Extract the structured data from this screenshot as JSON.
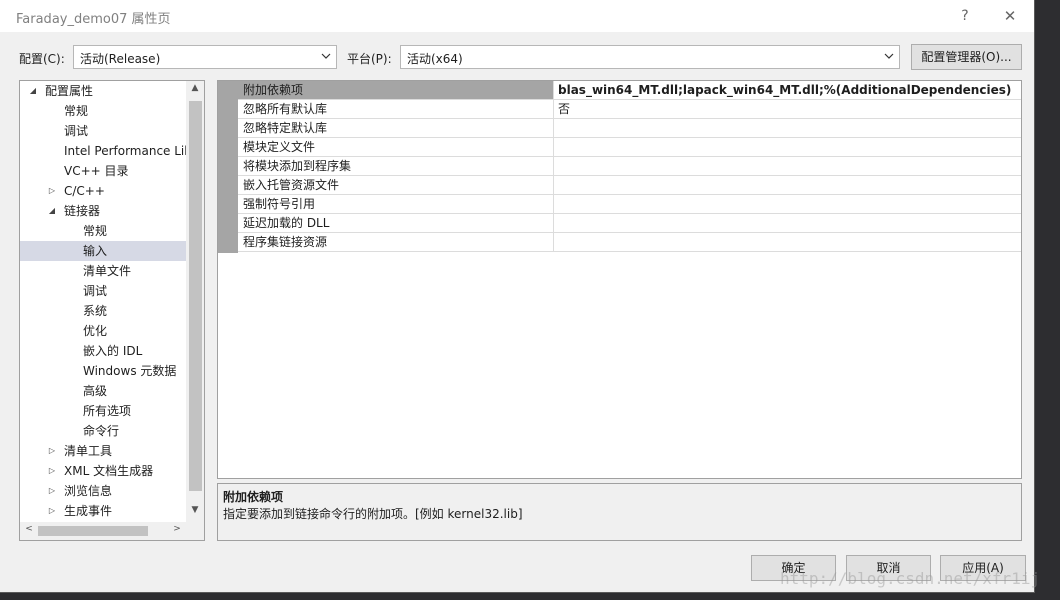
{
  "window": {
    "title": "Faraday_demo07 属性页",
    "help_glyph": "?",
    "close_glyph": "✕"
  },
  "toolbar": {
    "config_label": "配置(C):",
    "config_value": "活动(Release)",
    "platform_label": "平台(P):",
    "platform_value": "活动(x64)",
    "config_manager_label": "配置管理器(O)..."
  },
  "tree": {
    "items": [
      {
        "label": "配置属性",
        "toggle": "◢"
      },
      {
        "label": "常规",
        "toggle": ""
      },
      {
        "label": "调试",
        "toggle": ""
      },
      {
        "label": "Intel Performance Libraries",
        "toggle": ""
      },
      {
        "label": "VC++ 目录",
        "toggle": ""
      },
      {
        "label": "C/C++",
        "toggle": "▷"
      },
      {
        "label": "链接器",
        "toggle": "◢"
      },
      {
        "label": "常规",
        "toggle": ""
      },
      {
        "label": "输入",
        "toggle": ""
      },
      {
        "label": "清单文件",
        "toggle": ""
      },
      {
        "label": "调试",
        "toggle": ""
      },
      {
        "label": "系统",
        "toggle": ""
      },
      {
        "label": "优化",
        "toggle": ""
      },
      {
        "label": "嵌入的 IDL",
        "toggle": ""
      },
      {
        "label": "Windows 元数据",
        "toggle": ""
      },
      {
        "label": "高级",
        "toggle": ""
      },
      {
        "label": "所有选项",
        "toggle": ""
      },
      {
        "label": "命令行",
        "toggle": ""
      },
      {
        "label": "清单工具",
        "toggle": "▷"
      },
      {
        "label": "XML 文档生成器",
        "toggle": "▷"
      },
      {
        "label": "浏览信息",
        "toggle": "▷"
      },
      {
        "label": "生成事件",
        "toggle": "▷"
      }
    ],
    "scroll_up": "▲",
    "scroll_down": "▼",
    "scroll_left": "<",
    "scroll_right": ">"
  },
  "properties": [
    {
      "name": "附加依赖项",
      "value": "blas_win64_MT.dll;lapack_win64_MT.dll;%(AdditionalDependencies)"
    },
    {
      "name": "忽略所有默认库",
      "value": "否"
    },
    {
      "name": "忽略特定默认库",
      "value": ""
    },
    {
      "name": "模块定义文件",
      "value": ""
    },
    {
      "name": "将模块添加到程序集",
      "value": ""
    },
    {
      "name": "嵌入托管资源文件",
      "value": ""
    },
    {
      "name": "强制符号引用",
      "value": ""
    },
    {
      "name": "延迟加载的 DLL",
      "value": ""
    },
    {
      "name": "程序集链接资源",
      "value": ""
    }
  ],
  "description": {
    "title": "附加依赖项",
    "text": "指定要添加到链接命令行的附加项。[例如 kernel32.lib]"
  },
  "footer": {
    "ok_label": "确定",
    "cancel_label": "取消",
    "apply_label": "应用(A)"
  },
  "watermark": "http://blog.csdn.net/xfr1ij"
}
